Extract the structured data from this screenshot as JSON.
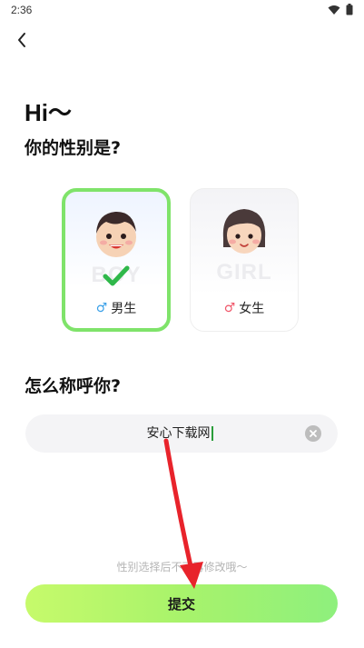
{
  "status_bar": {
    "time": "2:36"
  },
  "header": {
    "back_icon": "chevron-left-icon"
  },
  "greeting": "Hi～",
  "gender_question": "你的性别是?",
  "gender_options": [
    {
      "watermark": "BOY",
      "symbol": "♂",
      "label": "男生",
      "selected": true,
      "symbol_color": "#3aa0e8"
    },
    {
      "watermark": "GIRL",
      "symbol": "♂",
      "label": "女生",
      "selected": false,
      "symbol_color": "#f0576a"
    }
  ],
  "name_question": "怎么称呼你?",
  "name_input": {
    "value": "安心下载网"
  },
  "hint": "性别选择后不可再修改哦～",
  "submit_label": "提交",
  "colors": {
    "accent_border": "#7fe36a",
    "submit_gradient_start": "#c6fa6b",
    "submit_gradient_end": "#8ef07d",
    "annotation_arrow": "#e8232b"
  }
}
